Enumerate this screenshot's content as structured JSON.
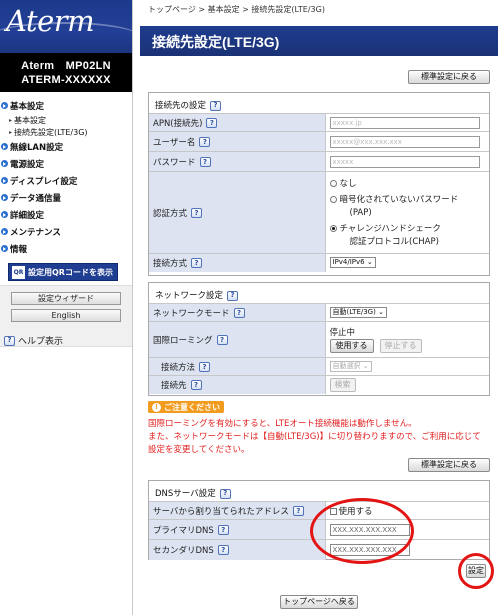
{
  "sidebar": {
    "logo": "Aterm",
    "model_line1": "Aterm　MP02LN",
    "model_line2": "ATERM-XXXXXX",
    "menu": [
      {
        "label": "基本設定",
        "subs": [
          "基本設定",
          "接続先設定(LTE/3G)"
        ]
      },
      {
        "label": "無線LAN設定"
      },
      {
        "label": "電源設定"
      },
      {
        "label": "ディスプレイ設定"
      },
      {
        "label": "データ通信量"
      },
      {
        "label": "詳細設定"
      },
      {
        "label": "メンテナンス"
      },
      {
        "label": "情報"
      }
    ],
    "qr_icon_text": "QR",
    "qr_button": "設定用QRコードを表示",
    "wizard_button": "設定ウィザード",
    "english_button": "English",
    "help_label": "ヘルプ表示"
  },
  "breadcrumb": "トップページ > 基本設定 > 接続先設定(LTE/3G)",
  "page_title": "接続先設定(LTE/3G)",
  "reset_button": "標準設定に戻る",
  "help_icon_text": "?",
  "connection": {
    "heading": "接続先の設定",
    "apn_label": "APN(接続先)",
    "apn_value": "xxxxx.jp",
    "user_label": "ユーザー名",
    "user_value": "xxxxx@xxx.xxx.xxx",
    "password_label": "パスワード",
    "password_value": "xxxxx",
    "auth_label": "認証方式",
    "auth_options": [
      "なし",
      "暗号化されていないパスワード",
      "(PAP)",
      "チャレンジハンドシェーク",
      "認証プロトコル(CHAP)"
    ],
    "auth_selected": "CHAP",
    "method_label": "接続方式",
    "method_value": "IPv4/IPv6"
  },
  "network": {
    "heading": "ネットワーク設定",
    "mode_label": "ネットワークモード",
    "mode_value": "自動(LTE/3G)",
    "roaming_label": "国際ローミング",
    "roaming_status": "停止中",
    "roaming_use_button": "使用する",
    "roaming_stop_button": "停止する",
    "conn_method_label": "接続方法",
    "conn_method_value": "自動選択",
    "conn_target_label": "接続先",
    "conn_target_button": "検索"
  },
  "notice": {
    "icon_text": "!",
    "title": "ご注意ください",
    "line1": "国際ローミングを有効にすると、LTEオート接続機能は動作しません。",
    "line2": "また、ネットワークモードは【自動(LTE/3G)】に切り替わりますので、ご利用に応じて",
    "line3": "設定を変更してください。"
  },
  "dns": {
    "heading": "DNSサーバ設定",
    "auto_label": "サーバから割り当てられたアドレス",
    "auto_checkbox": "使用する",
    "auto_checked": false,
    "primary_label": "プライマリDNS",
    "primary_value": "XXX.XXX.XXX.XXX",
    "secondary_label": "セカンダリDNS",
    "secondary_value": "XXX.XXX.XXX.XXX"
  },
  "set_button": "設定",
  "top_button": "トップページへ戻る",
  "colors": {
    "title_bar": "#1e3c8f",
    "label_bg": "#dde3f0",
    "notice": "#e21d1d",
    "highlight_ring": "#e31414"
  }
}
